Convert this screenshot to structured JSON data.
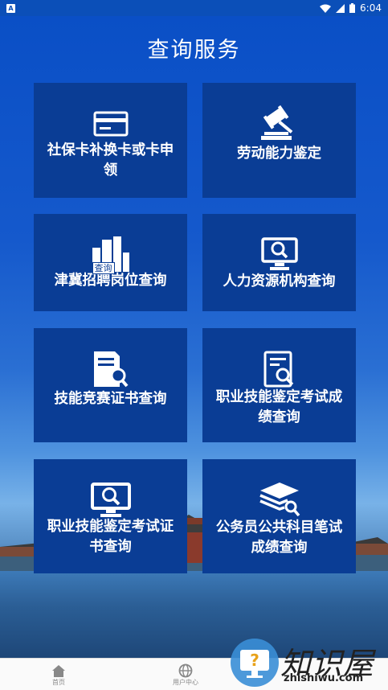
{
  "status_bar": {
    "app_badge": "A",
    "time": "6:04"
  },
  "page_title": "查询服务",
  "tiles": [
    {
      "label": "社保卡补换卡或卡申领",
      "icon": "card-icon"
    },
    {
      "label": "劳动能力鉴定",
      "icon": "gavel-icon"
    },
    {
      "label": "津冀招聘岗位查询",
      "icon": "building-search-icon",
      "icon_tag": "查询"
    },
    {
      "label": "人力资源机构查询",
      "icon": "monitor-search-icon"
    },
    {
      "label": "技能竞赛证书查询",
      "icon": "document-search-icon"
    },
    {
      "label": "职业技能鉴定考试成绩查询",
      "icon": "report-search-icon"
    },
    {
      "label": "职业技能鉴定考试证书查询",
      "icon": "monitor-search-icon"
    },
    {
      "label": "公务员公共科目笔试成绩查询",
      "icon": "stack-search-icon"
    }
  ],
  "bottom_nav": [
    {
      "label": "首页",
      "icon": "home-icon"
    },
    {
      "label": "用户中心",
      "icon": "globe-icon"
    }
  ],
  "watermark": {
    "text": "知识屋",
    "url": "zhishiwu.com"
  },
  "colors": {
    "tile_bg": "#0a3d95",
    "background_top": "#0a4fc6"
  }
}
